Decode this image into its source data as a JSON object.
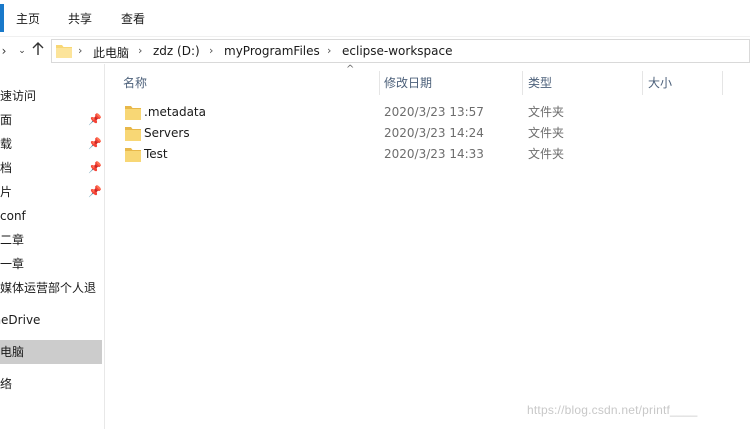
{
  "ribbon": {
    "tabs": [
      "主页",
      "共享",
      "查看"
    ]
  },
  "address": {
    "crumbs": [
      "此电脑",
      "zdz (D:)",
      "myProgramFiles",
      "eclipse-workspace"
    ]
  },
  "sidebar": {
    "items": [
      {
        "label": "快速访问",
        "pinned": false
      },
      {
        "label": "桌面",
        "pinned": true
      },
      {
        "label": "下载",
        "pinned": true
      },
      {
        "label": "文档",
        "pinned": true
      },
      {
        "label": "图片",
        "pinned": true
      },
      {
        "label": "conf",
        "pinned": false
      },
      {
        "label": "第二章",
        "pinned": false
      },
      {
        "label": "第一章",
        "pinned": false
      },
      {
        "label": "新媒体运营部个人退",
        "pinned": false
      },
      {
        "label": "OneDrive",
        "pinned": false
      },
      {
        "label": "此电脑",
        "pinned": false,
        "selected": true
      },
      {
        "label": "网络",
        "pinned": false
      }
    ]
  },
  "columns": {
    "name": "名称",
    "modified": "修改日期",
    "type": "类型",
    "size": "大小"
  },
  "files": [
    {
      "name": ".metadata",
      "modified": "2020/3/23 13:57",
      "type": "文件夹"
    },
    {
      "name": "Servers",
      "modified": "2020/3/23 14:24",
      "type": "文件夹"
    },
    {
      "name": "Test",
      "modified": "2020/3/23 14:33",
      "type": "文件夹"
    }
  ],
  "watermark": "https://blog.csdn.net/printf____",
  "colors": {
    "accent": "#1979ca",
    "folder": "#f8d775",
    "header_text": "#4c607a",
    "selected_bg": "#cccccc"
  }
}
